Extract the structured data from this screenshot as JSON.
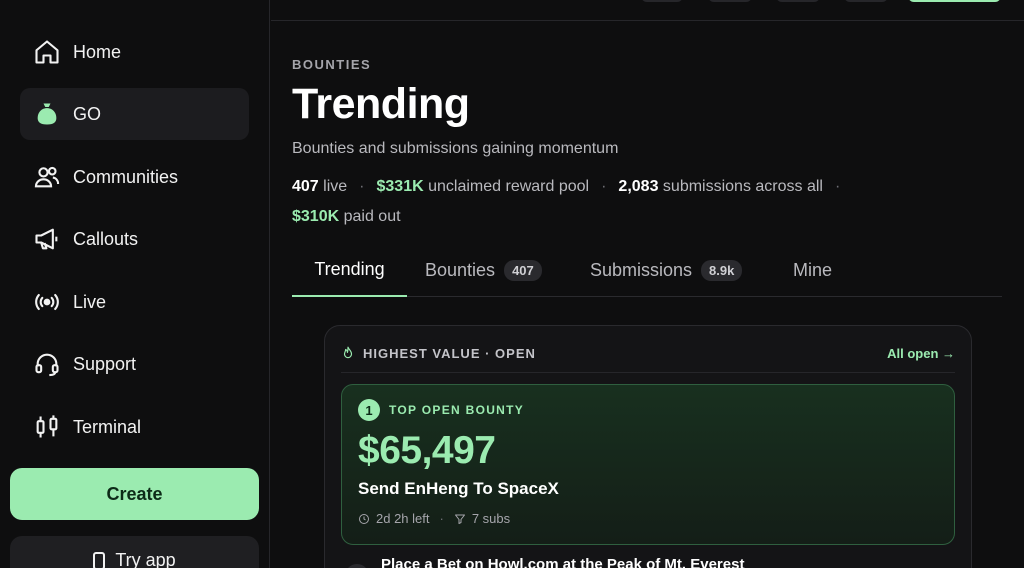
{
  "sidebar": {
    "items": [
      {
        "label": "Home",
        "icon": "home-icon"
      },
      {
        "label": "GO",
        "icon": "money-bag-icon",
        "active": true
      },
      {
        "label": "Communities",
        "icon": "users-icon"
      },
      {
        "label": "Callouts",
        "icon": "megaphone-icon"
      },
      {
        "label": "Live",
        "icon": "broadcast-icon"
      },
      {
        "label": "Support",
        "icon": "headset-icon"
      },
      {
        "label": "Terminal",
        "icon": "candlestick-icon"
      }
    ],
    "create_label": "Create",
    "tryapp_label": "Try app"
  },
  "header": {
    "eyebrow": "BOUNTIES",
    "title": "Trending",
    "subtitle": "Bounties and submissions gaining momentum"
  },
  "stats": {
    "live_count": "407",
    "live_label": "live",
    "pool_amount": "$331K",
    "pool_label": "unclaimed reward pool",
    "submissions_count": "2,083",
    "submissions_label": "submissions across all",
    "paid_amount": "$310K",
    "paid_label": "paid out"
  },
  "tabs": [
    {
      "label": "Trending",
      "active": true
    },
    {
      "label": "Bounties",
      "count": "407"
    },
    {
      "label": "Submissions",
      "count": "8.9k"
    },
    {
      "label": "Mine"
    }
  ],
  "card": {
    "heading": "HIGHEST VALUE · OPEN",
    "link": "All open →",
    "top_bounty": {
      "rank": "1",
      "label": "TOP OPEN BOUNTY",
      "amount": "$65,497",
      "title": "Send EnHeng To SpaceX",
      "time_left": "2d 2h left",
      "subs": "7 subs"
    },
    "next_title": "Place a Bet on Howl.com at the Peak of Mt. Everest"
  },
  "colors": {
    "accent": "#9bebb0",
    "background": "#0e0e0f",
    "surface": "#1c1c1f"
  }
}
